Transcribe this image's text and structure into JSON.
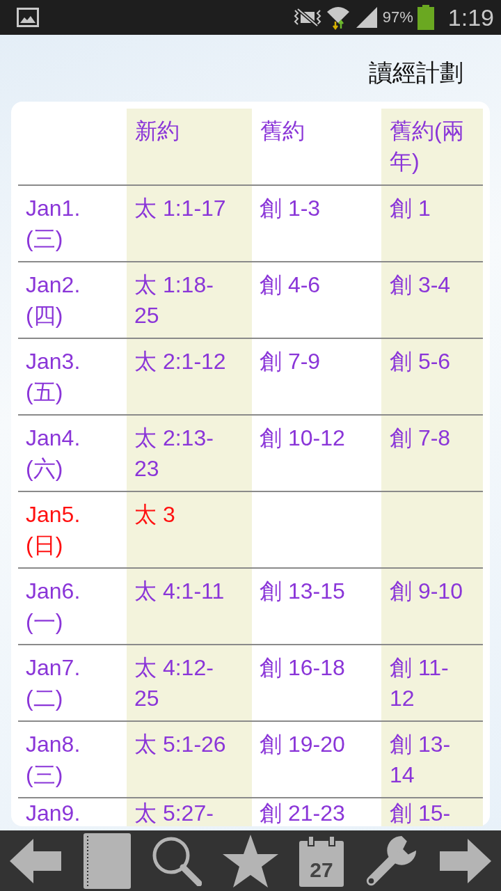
{
  "status_bar": {
    "battery": "97%",
    "time": "1:19"
  },
  "title": "讀經計劃",
  "table": {
    "columns": [
      "",
      "新約",
      "舊約",
      "舊約(兩年)"
    ],
    "rows": [
      {
        "date": "Jan1. (三)",
        "new_testament": "太 1:1-17",
        "old_testament": "創 1-3",
        "old_testament_two_year": "創 1",
        "sunday": false
      },
      {
        "date": "Jan2. (四)",
        "new_testament": "太 1:18-25",
        "old_testament": "創 4-6",
        "old_testament_two_year": "創 3-4",
        "sunday": false
      },
      {
        "date": "Jan3. (五)",
        "new_testament": "太 2:1-12",
        "old_testament": "創 7-9",
        "old_testament_two_year": "創 5-6",
        "sunday": false
      },
      {
        "date": "Jan4. (六)",
        "new_testament": "太 2:13-23",
        "old_testament": "創 10-12",
        "old_testament_two_year": "創 7-8",
        "sunday": false
      },
      {
        "date": "Jan5. (日)",
        "new_testament": "太 3",
        "sunday": true
      },
      {
        "date": "Jan6. (一)",
        "new_testament": "太 4:1-11",
        "old_testament": "創 13-15",
        "old_testament_two_year": "創 9-10",
        "sunday": false
      },
      {
        "date": "Jan7. (二)",
        "new_testament": "太 4:12-25",
        "old_testament": "創 16-18",
        "old_testament_two_year": "創 11-12",
        "sunday": false
      },
      {
        "date": "Jan8. (三)",
        "new_testament": "太 5:1-26",
        "old_testament": "創 19-20",
        "old_testament_two_year": "創 13-14",
        "sunday": false
      },
      {
        "date": "Jan9.",
        "new_testament": "太 5:27-",
        "old_testament": "創 21-23",
        "old_testament_two_year": "創 15-",
        "sunday": false
      }
    ]
  },
  "toolbar": {
    "calendar_day": "27"
  }
}
